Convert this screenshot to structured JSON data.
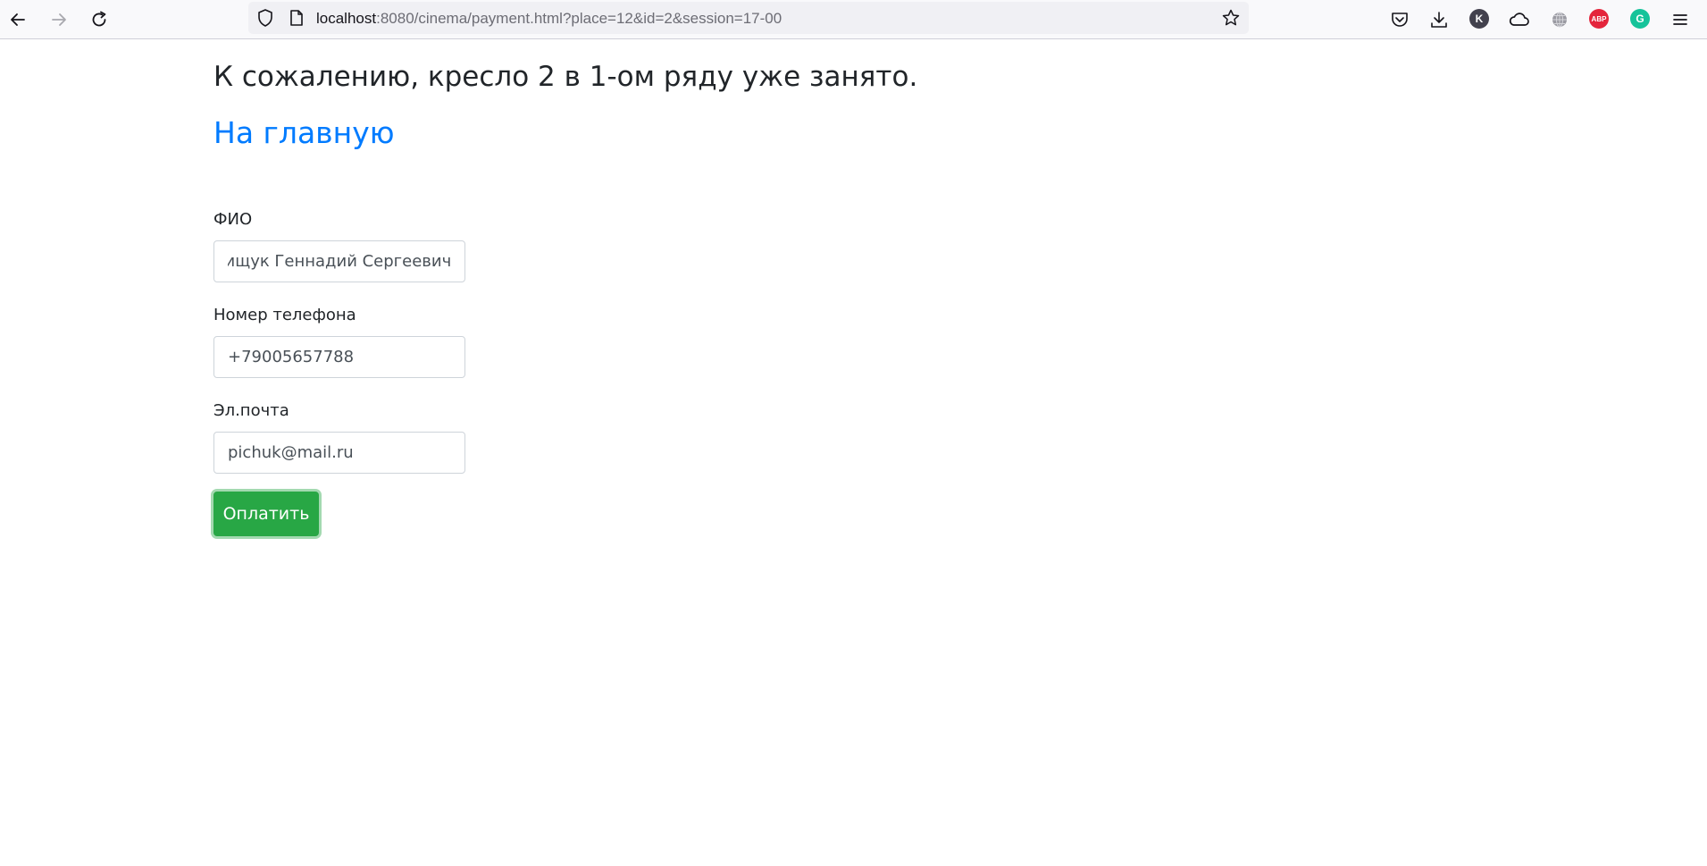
{
  "browser": {
    "url_host": "localhost",
    "url_rest": ":8080/cinema/payment.html?place=12&id=2&session=17-00",
    "icons": {
      "back": "back-arrow-icon",
      "forward": "forward-arrow-icon",
      "reload": "reload-icon",
      "shield": "tracking-protection-shield-icon",
      "page": "page-info-icon",
      "bookmark": "bookmark-star-icon",
      "pocket": "pocket-icon",
      "downloads": "downloads-icon",
      "extension_k": "k-extension-icon",
      "cloud": "cloud-icon",
      "globe": "globe-icon",
      "adblock": "adblock-plus-icon",
      "grammarly": "grammarly-icon",
      "menu": "hamburger-menu-icon"
    },
    "extensions": {
      "k_label": "K",
      "abp_label": "ABP",
      "grammarly_label": "G"
    },
    "colors": {
      "k_badge": "#42414d",
      "abp_badge": "#e4253c",
      "grammarly_badge": "#15c39a"
    }
  },
  "page": {
    "notice": "К сожалению, кресло 2 в 1-ом ряду уже занято.",
    "home_link": "На главную",
    "form": {
      "fio_label": "ФИО",
      "fio_value": "Пищук Геннадий Сергеевич",
      "phone_label": "Номер телефона",
      "phone_value": "+79005657788",
      "email_label": "Эл.почта",
      "email_value": "pichuk@mail.ru",
      "submit_label": "Оплатить"
    },
    "colors": {
      "link": "#007bff",
      "submit_button": "#28a745",
      "text": "#212529"
    }
  }
}
